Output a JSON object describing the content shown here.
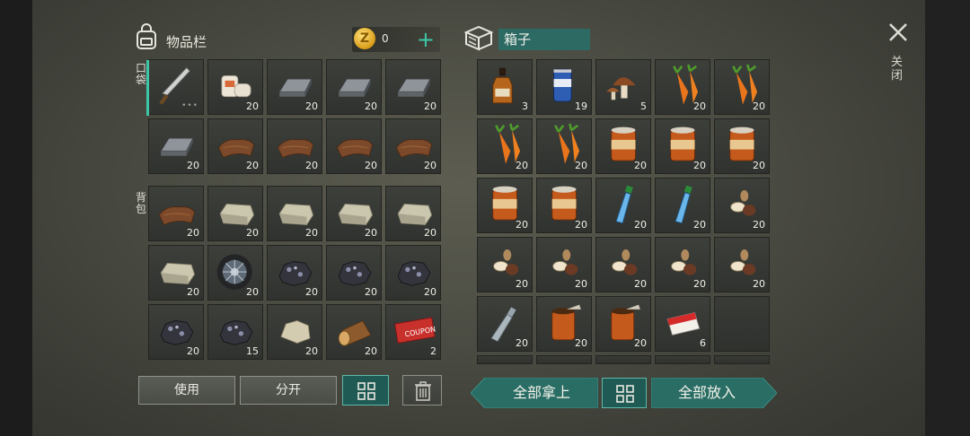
{
  "inventory": {
    "title": "物品栏",
    "coins": "0",
    "plus_icon": "plus-icon",
    "pocket_label": "口袋",
    "backpack_label": "背包",
    "pocket_slots": [
      {
        "item": "machete",
        "count": ""
      },
      {
        "item": "bandage",
        "count": "20"
      },
      {
        "item": "iron-ingot",
        "count": "20"
      },
      {
        "item": "iron-ingot",
        "count": "20"
      },
      {
        "item": "iron-ingot",
        "count": "20"
      },
      {
        "item": "iron-ingot",
        "count": "20"
      },
      {
        "item": "leather",
        "count": "20"
      },
      {
        "item": "leather",
        "count": "20"
      },
      {
        "item": "leather",
        "count": "20"
      },
      {
        "item": "leather",
        "count": "20"
      }
    ],
    "backpack_slots": [
      {
        "item": "leather",
        "count": "20"
      },
      {
        "item": "stone-block",
        "count": "20"
      },
      {
        "item": "stone-block",
        "count": "20"
      },
      {
        "item": "stone-block",
        "count": "20"
      },
      {
        "item": "stone-block",
        "count": "20"
      },
      {
        "item": "stone-block",
        "count": "20"
      },
      {
        "item": "tire",
        "count": "20"
      },
      {
        "item": "coal-ore",
        "count": "20"
      },
      {
        "item": "coal-ore",
        "count": "20"
      },
      {
        "item": "coal-ore",
        "count": "20"
      },
      {
        "item": "coal-ore",
        "count": "20"
      },
      {
        "item": "coal-ore",
        "count": "15"
      },
      {
        "item": "stone",
        "count": "20"
      },
      {
        "item": "wood-log",
        "count": "20"
      },
      {
        "item": "coupon",
        "count": "2"
      }
    ],
    "use_label": "使用",
    "split_label": "分开"
  },
  "box": {
    "title": "箱子",
    "slots": [
      {
        "item": "whiskey",
        "count": "3"
      },
      {
        "item": "soda-can",
        "count": "19"
      },
      {
        "item": "mushroom",
        "count": "5"
      },
      {
        "item": "carrot",
        "count": "20"
      },
      {
        "item": "carrot",
        "count": "20"
      },
      {
        "item": "carrot",
        "count": "20"
      },
      {
        "item": "carrot",
        "count": "20"
      },
      {
        "item": "canned-food",
        "count": "20"
      },
      {
        "item": "canned-food",
        "count": "20"
      },
      {
        "item": "canned-food",
        "count": "20"
      },
      {
        "item": "canned-food",
        "count": "20"
      },
      {
        "item": "canned-food",
        "count": "20"
      },
      {
        "item": "water-bottle",
        "count": "20"
      },
      {
        "item": "water-bottle",
        "count": "20"
      },
      {
        "item": "nuts",
        "count": "20"
      },
      {
        "item": "nuts",
        "count": "20"
      },
      {
        "item": "nuts",
        "count": "20"
      },
      {
        "item": "nuts",
        "count": "20"
      },
      {
        "item": "nuts",
        "count": "20"
      },
      {
        "item": "nuts",
        "count": "20"
      },
      {
        "item": "empty-bottle",
        "count": "20"
      },
      {
        "item": "open-can",
        "count": "20"
      },
      {
        "item": "open-can",
        "count": "20"
      },
      {
        "item": "cigarettes",
        "count": "6"
      },
      {
        "item": "",
        "count": ""
      }
    ],
    "take_all_label": "全部拿上",
    "put_all_label": "全部放入"
  },
  "close_label": "关闭",
  "colors": {
    "accent": "#3cc8a8",
    "button_teal": "#2a6d65",
    "panel": "#4a4b42"
  }
}
